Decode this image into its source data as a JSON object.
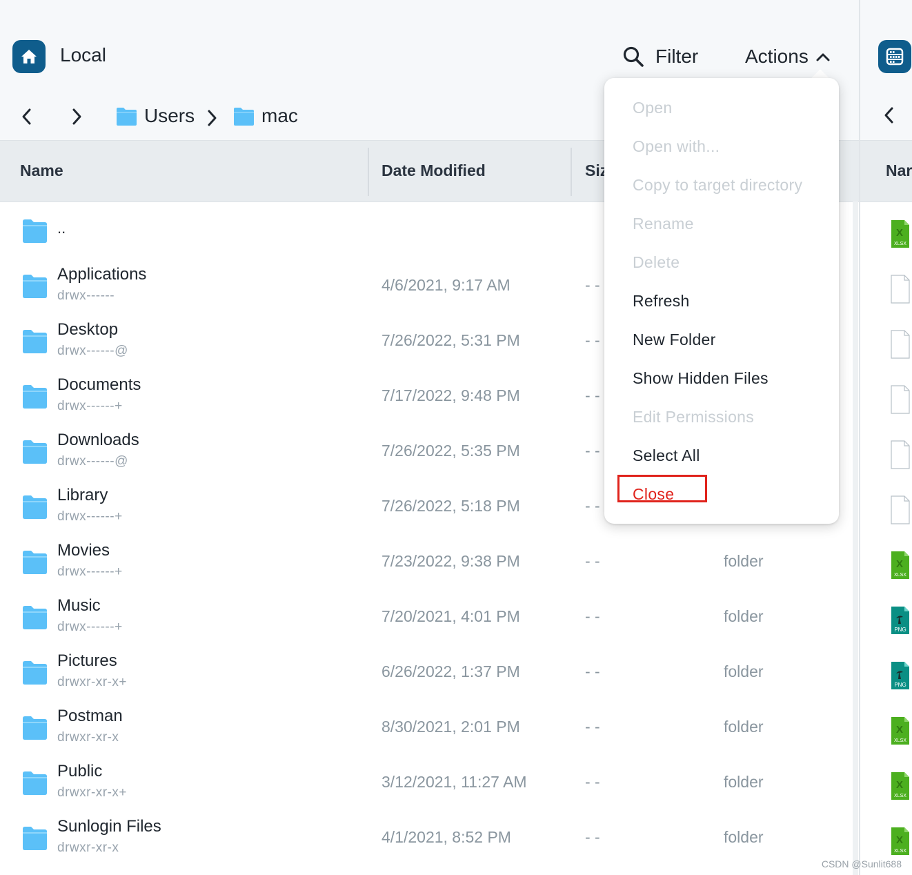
{
  "left_pane": {
    "title": "Local",
    "filter_label": "Filter",
    "actions_label": "Actions",
    "breadcrumb": [
      "Users",
      "mac"
    ],
    "columns": {
      "name": "Name",
      "date": "Date Modified",
      "size": "Siz"
    },
    "parent_row": {
      "name": ".."
    },
    "rows": [
      {
        "name": "Applications",
        "perm": "drwx------",
        "date": "4/6/2021, 9:17 AM",
        "size": "- -",
        "kind": ""
      },
      {
        "name": "Desktop",
        "perm": "drwx------@",
        "date": "7/26/2022, 5:31 PM",
        "size": "- -",
        "kind": ""
      },
      {
        "name": "Documents",
        "perm": "drwx------+",
        "date": "7/17/2022, 9:48 PM",
        "size": "- -",
        "kind": ""
      },
      {
        "name": "Downloads",
        "perm": "drwx------@",
        "date": "7/26/2022, 5:35 PM",
        "size": "- -",
        "kind": ""
      },
      {
        "name": "Library",
        "perm": "drwx------+",
        "date": "7/26/2022, 5:18 PM",
        "size": "- -",
        "kind": ""
      },
      {
        "name": "Movies",
        "perm": "drwx------+",
        "date": "7/23/2022, 9:38 PM",
        "size": "- -",
        "kind": "folder"
      },
      {
        "name": "Music",
        "perm": "drwx------+",
        "date": "7/20/2021, 4:01 PM",
        "size": "- -",
        "kind": "folder"
      },
      {
        "name": "Pictures",
        "perm": "drwxr-xr-x+",
        "date": "6/26/2022, 1:37 PM",
        "size": "- -",
        "kind": "folder"
      },
      {
        "name": "Postman",
        "perm": "drwxr-xr-x",
        "date": "8/30/2021, 2:01 PM",
        "size": "- -",
        "kind": "folder"
      },
      {
        "name": "Public",
        "perm": "drwxr-xr-x+",
        "date": "3/12/2021, 11:27 AM",
        "size": "- -",
        "kind": "folder"
      },
      {
        "name": "Sunlogin Files",
        "perm": "drwxr-xr-x",
        "date": "4/1/2021, 8:52 PM",
        "size": "- -",
        "kind": "folder"
      }
    ]
  },
  "right_pane": {
    "column_name": "Nar",
    "file_icons": [
      "xlsx",
      "file",
      "file",
      "file",
      "file",
      "file",
      "xlsx",
      "png",
      "png",
      "xlsx",
      "xlsx",
      "xlsx"
    ],
    "xlsx_badge": "XLSX",
    "png_badge": "PNG"
  },
  "actions_menu": {
    "items": [
      {
        "label": "Open",
        "enabled": false
      },
      {
        "label": "Open with...",
        "enabled": false
      },
      {
        "label": "Copy to target directory",
        "enabled": false
      },
      {
        "label": "Rename",
        "enabled": false
      },
      {
        "label": "Delete",
        "enabled": false
      },
      {
        "label": "Refresh",
        "enabled": true
      },
      {
        "label": "New Folder",
        "enabled": true
      },
      {
        "label": "Show Hidden Files",
        "enabled": true
      },
      {
        "label": "Edit Permissions",
        "enabled": false
      },
      {
        "label": "Select All",
        "enabled": true
      },
      {
        "label": "Close",
        "enabled": true,
        "highlighted": true
      }
    ]
  },
  "watermark": "CSDN @Sunlit688",
  "colors": {
    "brand": "#0f5d8c",
    "folder": "#5bc0f8",
    "danger": "#e0231c",
    "xlsx": "#4caf1f",
    "png": "#0a8f84"
  }
}
